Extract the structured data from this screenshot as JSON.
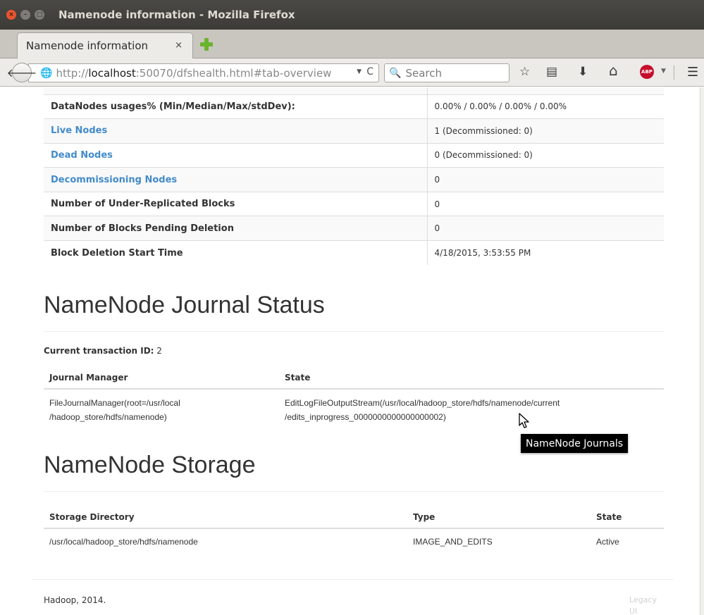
{
  "window": {
    "title": "Namenode information - Mozilla Firefox",
    "close_glyph": "×",
    "min_glyph": "–",
    "max_glyph": "□"
  },
  "tab": {
    "title": "Namenode information",
    "close_glyph": "×"
  },
  "navbar": {
    "back_glyph": "🡐",
    "url_scheme": "http://",
    "url_host": "localhost",
    "url_rest": ":50070/dfshealth.html#tab-overview",
    "url_drop_glyph": "▼",
    "reload_glyph": "C",
    "search_placeholder": "Search"
  },
  "toolbar": {
    "bookmark_glyph": "☆",
    "reader_glyph": "▤",
    "download_glyph": "⬇",
    "home_glyph": "⌂",
    "abp_label": "ABP",
    "abp_drop_glyph": "▼",
    "menu_glyph": "☰"
  },
  "summary": {
    "rows": [
      {
        "key": "DataNodes usages% (Min/Median/Max/stdDev):",
        "value": "0.00% / 0.00% / 0.00% / 0.00%",
        "link": false
      },
      {
        "key": "Live Nodes",
        "value": "1 (Decommissioned: 0)",
        "link": true
      },
      {
        "key": "Dead Nodes",
        "value": "0 (Decommissioned: 0)",
        "link": true
      },
      {
        "key": "Decommissioning Nodes",
        "value": "0",
        "link": true
      },
      {
        "key": "Number of Under-Replicated Blocks",
        "value": "0",
        "link": false
      },
      {
        "key": "Number of Blocks Pending Deletion",
        "value": "0",
        "link": false
      },
      {
        "key": "Block Deletion Start Time",
        "value": "4/18/2015, 3:53:55 PM",
        "link": false
      }
    ]
  },
  "journal": {
    "heading": "NameNode Journal Status",
    "txid_label": "Current transaction ID:",
    "txid_value": "2",
    "headers": [
      "Journal Manager",
      "State"
    ],
    "rows": [
      {
        "manager_line1": "FileJournalManager(root=/usr/local",
        "manager_line2": "/hadoop_store/hdfs/namenode)",
        "state_line1": "EditLogFileOutputStream(/usr/local/hadoop_store/hdfs/namenode/current",
        "state_line2": "/edits_inprogress_0000000000000000002)"
      }
    ]
  },
  "storage": {
    "heading": "NameNode Storage",
    "headers": [
      "Storage Directory",
      "Type",
      "State"
    ],
    "rows": [
      {
        "dir": "/usr/local/hadoop_store/hdfs/namenode",
        "type": "IMAGE_AND_EDITS",
        "state": "Active"
      }
    ]
  },
  "tooltip": {
    "text": "NameNode Journals"
  },
  "footer": {
    "text": "Hadoop, 2014.",
    "legacy_line1": "Legacy",
    "legacy_line2": "UI"
  }
}
